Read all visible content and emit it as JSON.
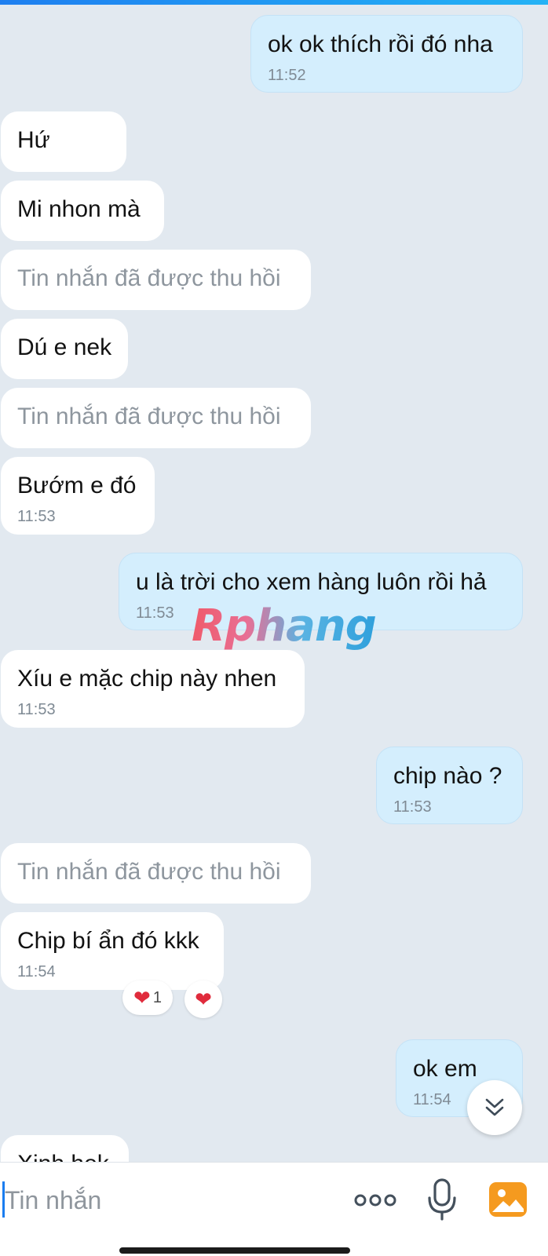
{
  "messages": [
    {
      "dir": "out",
      "text": "ok ok thích rồi đó nha",
      "time": "11:52"
    },
    {
      "dir": "in",
      "text": "Hứ"
    },
    {
      "dir": "in",
      "text": "Mi nhon mà"
    },
    {
      "dir": "in",
      "text": "Tin nhắn đã được thu hồi",
      "recalled": true
    },
    {
      "dir": "in",
      "text": "Dú e nek"
    },
    {
      "dir": "in",
      "text": "Tin nhắn đã được thu hồi",
      "recalled": true
    },
    {
      "dir": "in",
      "text": "Bướm e đó",
      "time": "11:53"
    },
    {
      "dir": "out",
      "text": "u là trời cho xem hàng luôn rồi hả",
      "time": "11:53"
    },
    {
      "dir": "in",
      "text": "Xíu e mặc chip này nhen",
      "time": "11:53"
    },
    {
      "dir": "out",
      "text": "chip nào ?",
      "time": "11:53"
    },
    {
      "dir": "in",
      "text": "Tin nhắn đã được thu hồi",
      "recalled": true
    },
    {
      "dir": "in",
      "text": "Chip bí ẩn đó kkk",
      "time": "11:54"
    },
    {
      "dir": "out",
      "text": "ok em",
      "time": "11:54"
    },
    {
      "dir": "in",
      "text": "Xinh hok"
    }
  ],
  "reactions": [
    {
      "emoji": "heart",
      "count": "1"
    },
    {
      "emoji": "heart"
    }
  ],
  "watermark": "Rphang",
  "input": {
    "placeholder": "Tin nhắn"
  },
  "icons": {
    "more": "more-dots-icon",
    "mic": "microphone-icon",
    "image": "image-gallery-icon",
    "scroll": "double-chevron-down-icon"
  },
  "colors": {
    "background": "#e2e9f0",
    "incoming_bubble": "#ffffff",
    "outgoing_bubble": "#d4eefd",
    "accent": "#1a7df0",
    "heart": "#e02b3c",
    "image_icon": "#f59a1f"
  }
}
